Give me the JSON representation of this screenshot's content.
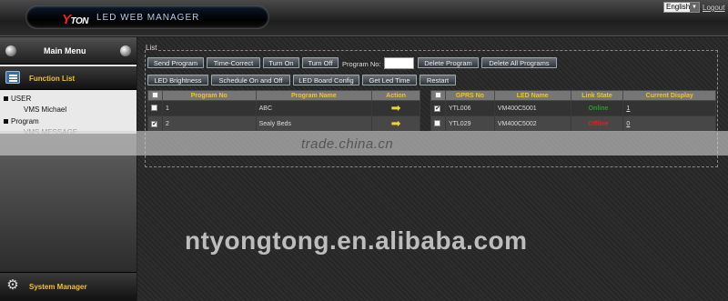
{
  "header": {
    "brand": "TON",
    "brand_v": "Y",
    "title": "LED WEB MANAGER",
    "language": "English",
    "logout": "Logout"
  },
  "sidebar": {
    "main_menu": "Main Menu",
    "function_list": "Function List",
    "tree": [
      {
        "label": "USER"
      },
      {
        "label": "VMS Michael"
      },
      {
        "label": "Program"
      },
      {
        "label": "VMS MESSAGE"
      }
    ],
    "system_manager": "System Manager"
  },
  "list": {
    "legend": "List",
    "buttons_row1": [
      "Send Program",
      "Time-Correct",
      "Turn On",
      "Turn Off"
    ],
    "program_no_label": "Program No:",
    "program_no_value": "",
    "buttons_row1b": [
      "Delete Program",
      "Delete All Programs"
    ],
    "buttons_row2": [
      "LED Brightness",
      "Schedule On and Off",
      "LED Board Config",
      "Get Led Time",
      "Restart"
    ]
  },
  "program_table": {
    "headers": [
      "Program No",
      "Program Name",
      "Action"
    ],
    "rows": [
      {
        "no": "1",
        "name": "ABC",
        "checked": false
      },
      {
        "no": "2",
        "name": "Sealy Beds",
        "checked": true
      }
    ]
  },
  "device_table": {
    "headers": [
      "GPRS No",
      "LED Name",
      "Link State",
      "Current Display"
    ],
    "rows": [
      {
        "gprs": "YTL006",
        "led": "VM400C5001",
        "state": "Online",
        "display": "1",
        "checked": true
      },
      {
        "gprs": "YTL029",
        "led": "VM400C5002",
        "state": "Offline",
        "display": "0",
        "checked": false
      }
    ]
  },
  "watermark": {
    "strip_text": "trade.china.cn",
    "bottom_text": "ntyongtong.en.alibaba.com"
  },
  "colors": {
    "accent_yellow": "#f2c230",
    "online_green": "#2a9a2a",
    "offline_red": "#e02020"
  }
}
